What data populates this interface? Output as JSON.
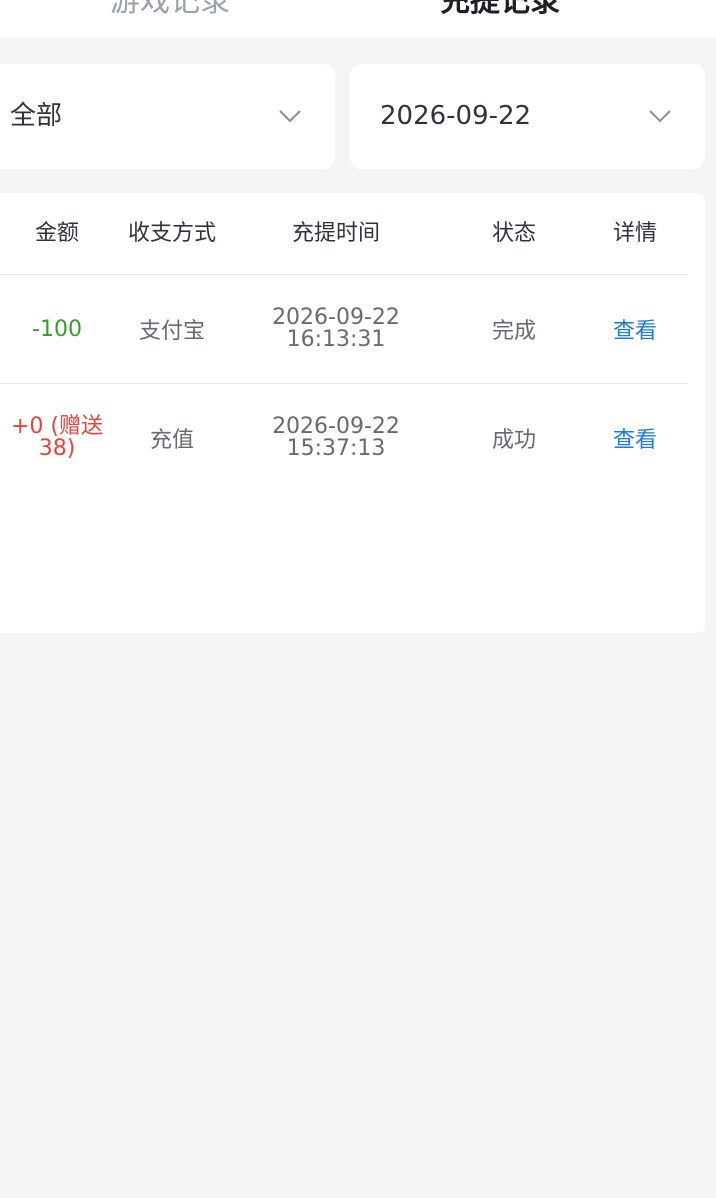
{
  "tabs": {
    "game_records": "游戏记录",
    "recharge_records": "充提记录"
  },
  "filters": {
    "type": {
      "value": "全部",
      "icon": "chevron-down-icon"
    },
    "date": {
      "value": "2026-09-22",
      "icon": "chevron-down-icon"
    }
  },
  "table": {
    "headers": {
      "amount": "金额",
      "method": "收支方式",
      "time": "充提时间",
      "status": "状态",
      "details": "详情"
    },
    "rows": [
      {
        "amount": "-100",
        "method": "支付宝",
        "date": "2026-09-22",
        "time": "16:13:31",
        "status": "完成",
        "action": "查看"
      },
      {
        "amount_line1": "+0 (赠送",
        "amount_line2": "38)",
        "method": "充值",
        "date": "2026-09-22",
        "time": "15:37:13",
        "status": "成功",
        "action": "查看"
      }
    ]
  },
  "colors": {
    "background": "#f4f4f5",
    "negative_amount": "#3a9a2a",
    "positive_amount": "#e0463a",
    "link": "#1e7be0"
  }
}
